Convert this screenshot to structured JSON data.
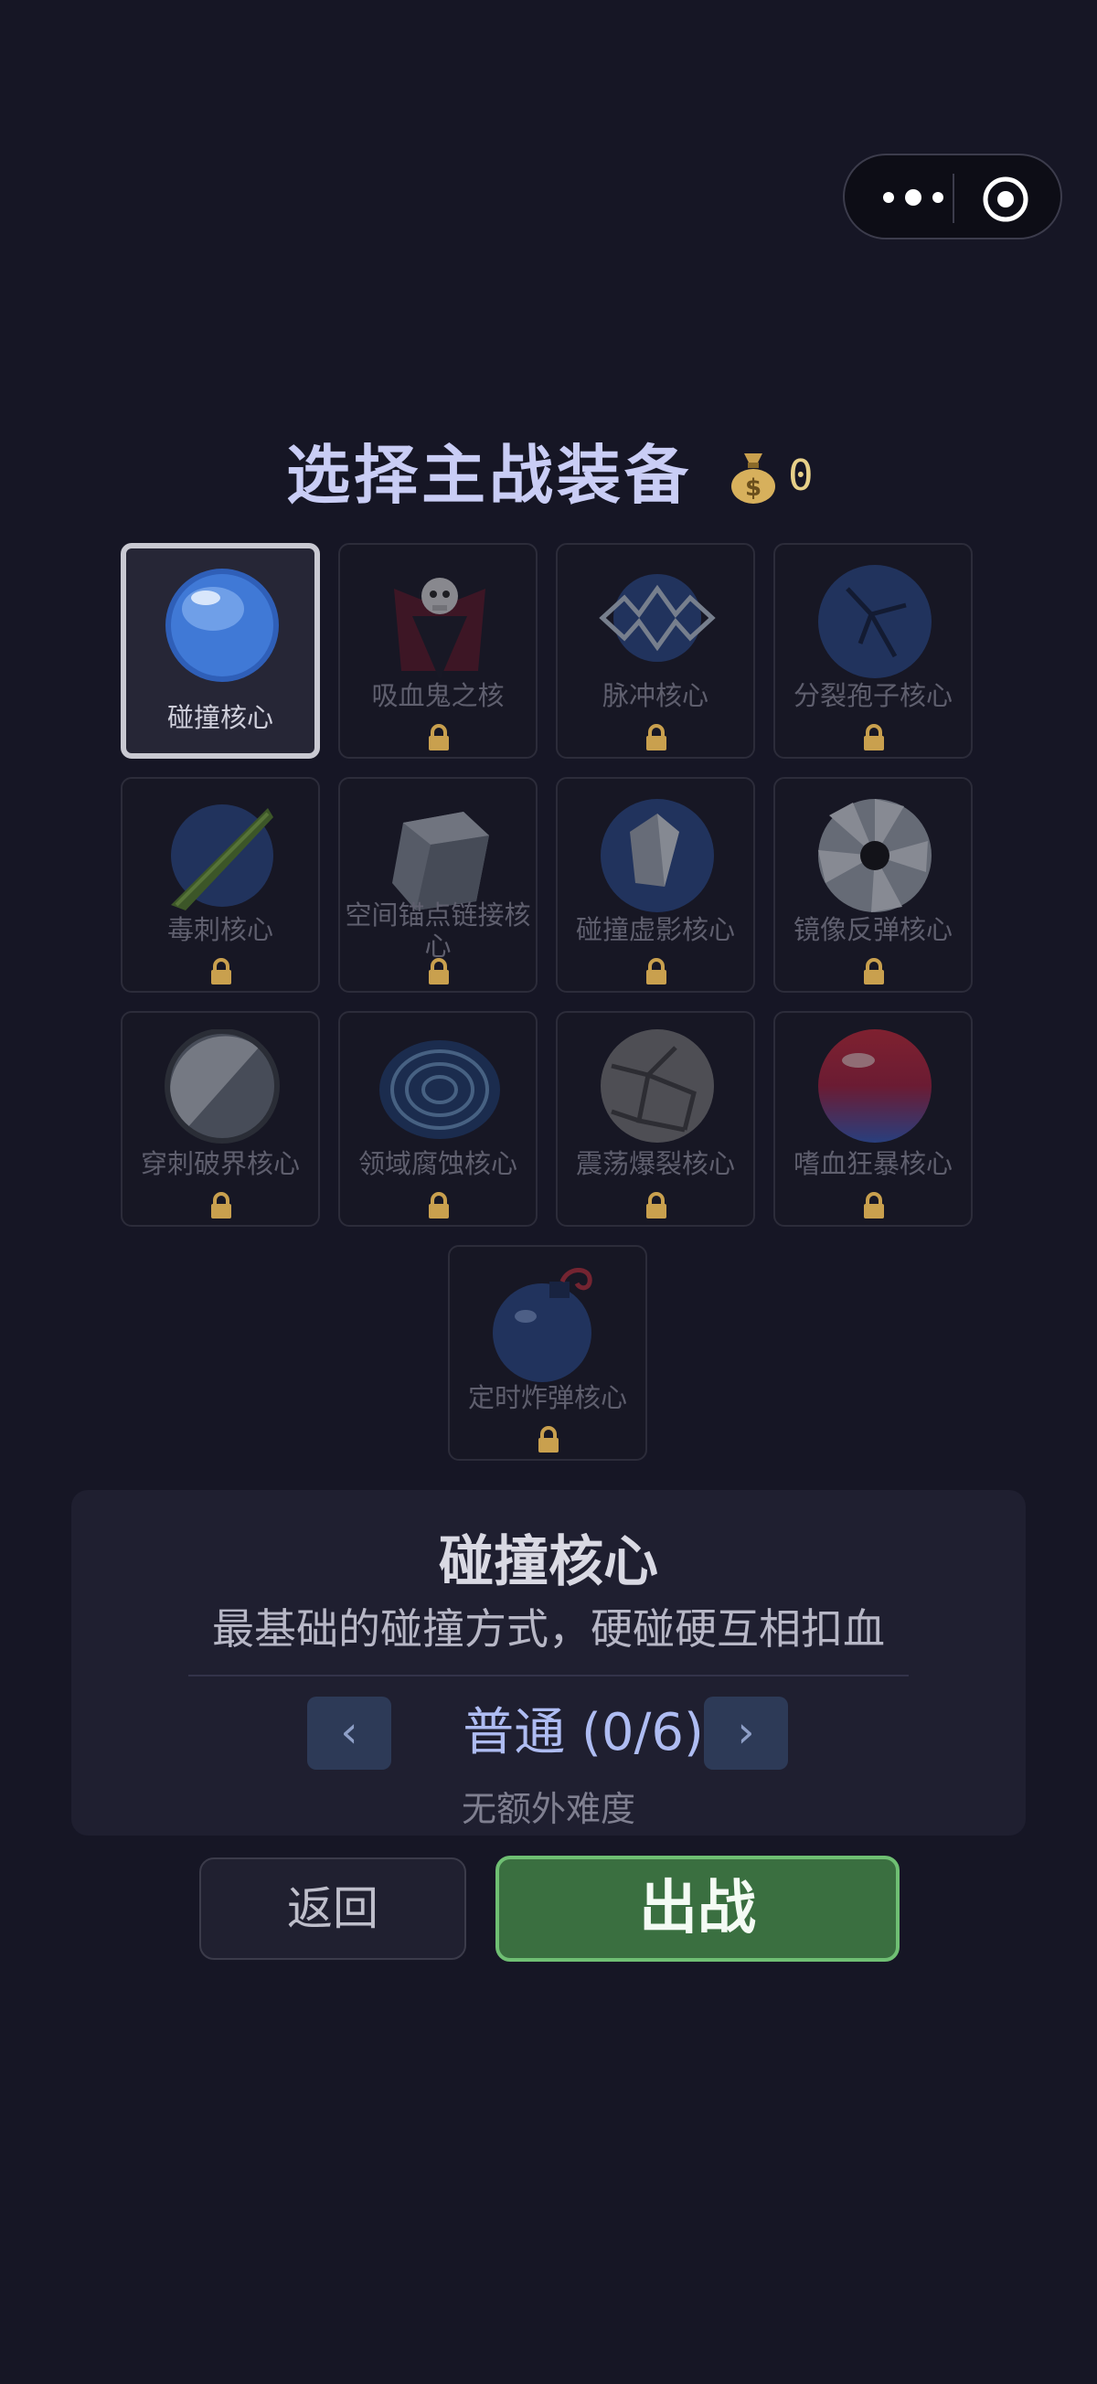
{
  "title": "选择主战装备",
  "coins": "0",
  "cards": [
    {
      "name": "碰撞核心",
      "locked": false,
      "selected": true
    },
    {
      "name": "吸血鬼之核",
      "locked": true
    },
    {
      "name": "脉冲核心",
      "locked": true
    },
    {
      "name": "分裂孢子核心",
      "locked": true
    },
    {
      "name": "毒刺核心",
      "locked": true
    },
    {
      "name": "空间锚点链接核心",
      "locked": true
    },
    {
      "name": "碰撞虚影核心",
      "locked": true
    },
    {
      "name": "镜像反弹核心",
      "locked": true
    },
    {
      "name": "穿刺破界核心",
      "locked": true
    },
    {
      "name": "领域腐蚀核心",
      "locked": true
    },
    {
      "name": "震荡爆裂核心",
      "locked": true
    },
    {
      "name": "嗜血狂暴核心",
      "locked": true
    },
    {
      "name": "定时炸弹核心",
      "locked": true
    }
  ],
  "info": {
    "name": "碰撞核心",
    "description": "最基础的碰撞方式，硬碰硬互相扣血",
    "difficulty": "普通 (0/6)",
    "difficulty_note": "无额外难度",
    "prev_icon": "chevron-left",
    "next_icon": "chevron-right"
  },
  "buttons": {
    "back": "返回",
    "go": "出战"
  },
  "colors": {
    "background": "#161625",
    "title": "#c9cdf5",
    "go_button": "#3a6f40",
    "go_border": "#6fbf73",
    "lock": "#c9a04e"
  }
}
